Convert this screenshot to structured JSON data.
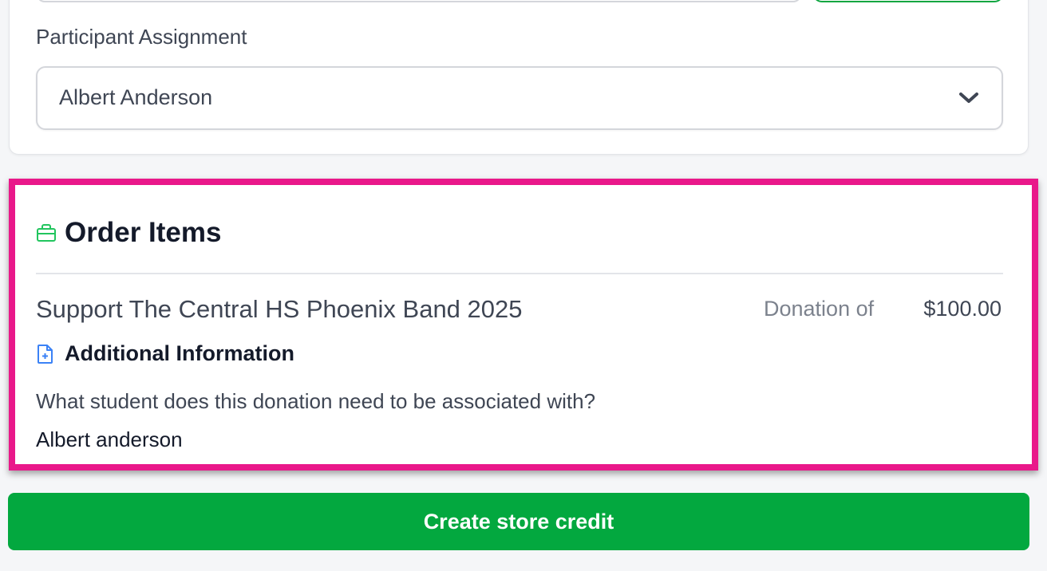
{
  "participant": {
    "label": "Participant Assignment",
    "selected_value": "Albert Anderson"
  },
  "order_items": {
    "title": "Order Items",
    "items": [
      {
        "name": "Support The Central HS Phoenix Band 2025",
        "type_label": "Donation of",
        "price": "$100.00"
      }
    ],
    "additional_info": {
      "title": "Additional Information",
      "question": "What student does this donation need to be associated with?",
      "answer": "Albert anderson"
    }
  },
  "actions": {
    "create_store_credit_label": "Create store credit"
  },
  "colors": {
    "accent_green": "#03a83f",
    "highlight_pink": "#e9188a",
    "icon_blue": "#3b82f6"
  },
  "icons": {
    "select": "chevron-down-icon",
    "order_items": "shopping-bag-icon",
    "additional_info": "document-plus-icon"
  }
}
